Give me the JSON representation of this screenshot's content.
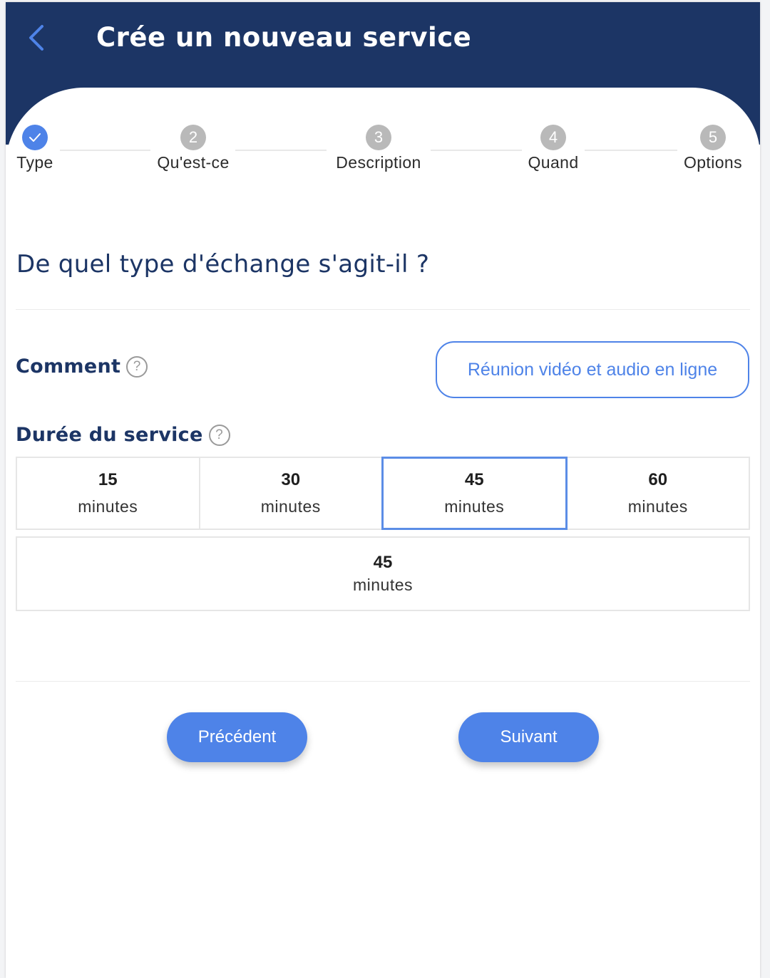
{
  "header": {
    "title": "Crée un nouveau service"
  },
  "stepper": {
    "steps": [
      {
        "number": "",
        "label": "Type",
        "done": true
      },
      {
        "number": "2",
        "label": "Qu'est-ce"
      },
      {
        "number": "3",
        "label": "Description"
      },
      {
        "number": "4",
        "label": "Quand"
      },
      {
        "number": "5",
        "label": "Options"
      }
    ]
  },
  "form": {
    "question": "De quel type d'échange s'agit-il ?",
    "comment_label": "Comment",
    "comment_value": "Réunion vidéo et audio en ligne",
    "duration_label": "Durée du service",
    "help_glyph": "?",
    "durations": [
      {
        "value": "15",
        "unit": "minutes"
      },
      {
        "value": "30",
        "unit": "minutes"
      },
      {
        "value": "45",
        "unit": "minutes",
        "selected": true
      },
      {
        "value": "60",
        "unit": "minutes"
      }
    ],
    "selected_duration": {
      "value": "45",
      "unit": "minutes"
    }
  },
  "nav": {
    "previous_label": "Précédent",
    "next_label": "Suivant"
  },
  "colors": {
    "header_bg": "#1c3565",
    "accent": "#4e83e8",
    "step_inactive": "#b9b9b9",
    "title_text": "#1c3565"
  }
}
